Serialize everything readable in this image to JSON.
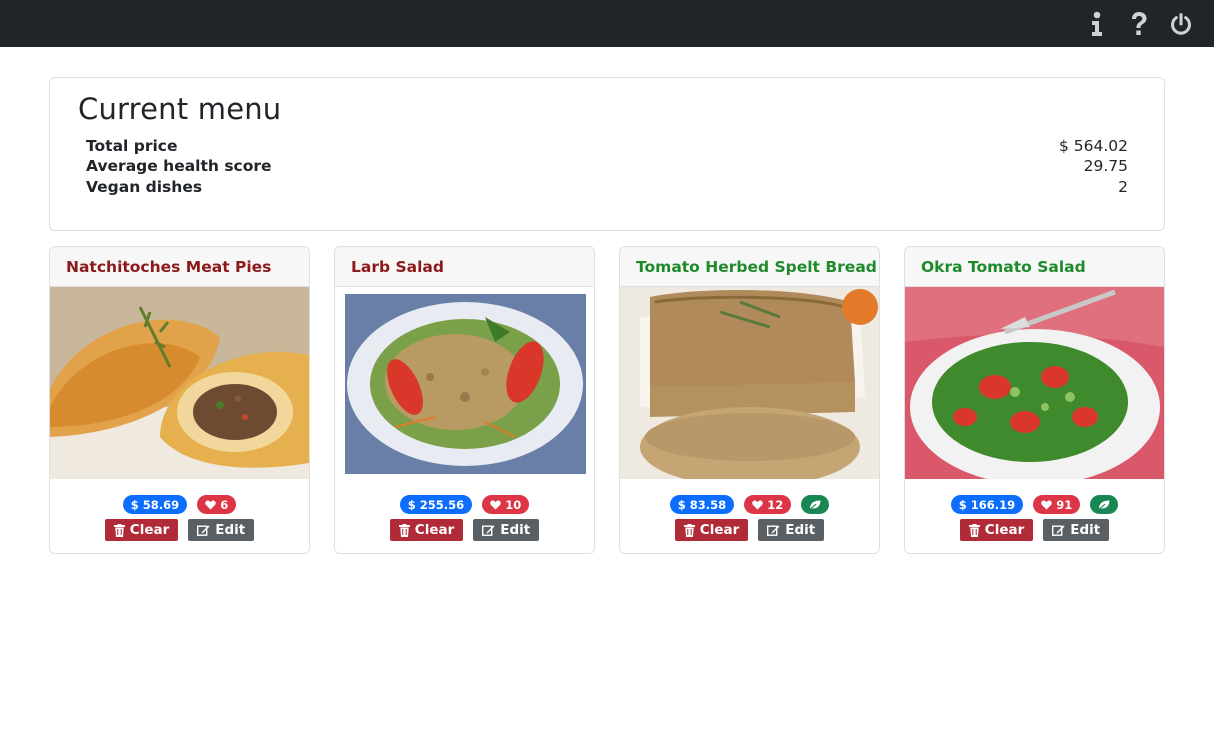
{
  "nav": {
    "icons": [
      "info-icon",
      "question-icon",
      "power-icon"
    ]
  },
  "summary": {
    "title": "Current menu",
    "rows": [
      {
        "label": "Total price",
        "value": "$ 564.02"
      },
      {
        "label": "Average health score",
        "value": "29.75"
      },
      {
        "label": "Vegan dishes",
        "value": "2"
      }
    ]
  },
  "dishes": [
    {
      "name": "Natchitoches Meat Pies",
      "title_color": "red",
      "price": "$ 58.69",
      "health": "6",
      "vegan": false,
      "clear_label": "Clear",
      "edit_label": "Edit"
    },
    {
      "name": "Larb Salad",
      "title_color": "red",
      "price": "$ 255.56",
      "health": "10",
      "vegan": false,
      "clear_label": "Clear",
      "edit_label": "Edit"
    },
    {
      "name": "Tomato Herbed Spelt Bread",
      "title_color": "green",
      "price": "$ 83.58",
      "health": "12",
      "vegan": true,
      "clear_label": "Clear",
      "edit_label": "Edit"
    },
    {
      "name": "Okra Tomato Salad",
      "title_color": "green",
      "price": "$ 166.19",
      "health": "91",
      "vegan": true,
      "clear_label": "Clear",
      "edit_label": "Edit"
    }
  ],
  "colors": {
    "navbar": "#212529",
    "price_badge": "#0d6efd",
    "health_badge": "#dc3545",
    "vegan_badge": "#198754",
    "clear_button": "#b02a37",
    "edit_button": "#5a5f63",
    "non_vegan_title": "#8b1a1a",
    "vegan_title": "#1f8a2c"
  }
}
